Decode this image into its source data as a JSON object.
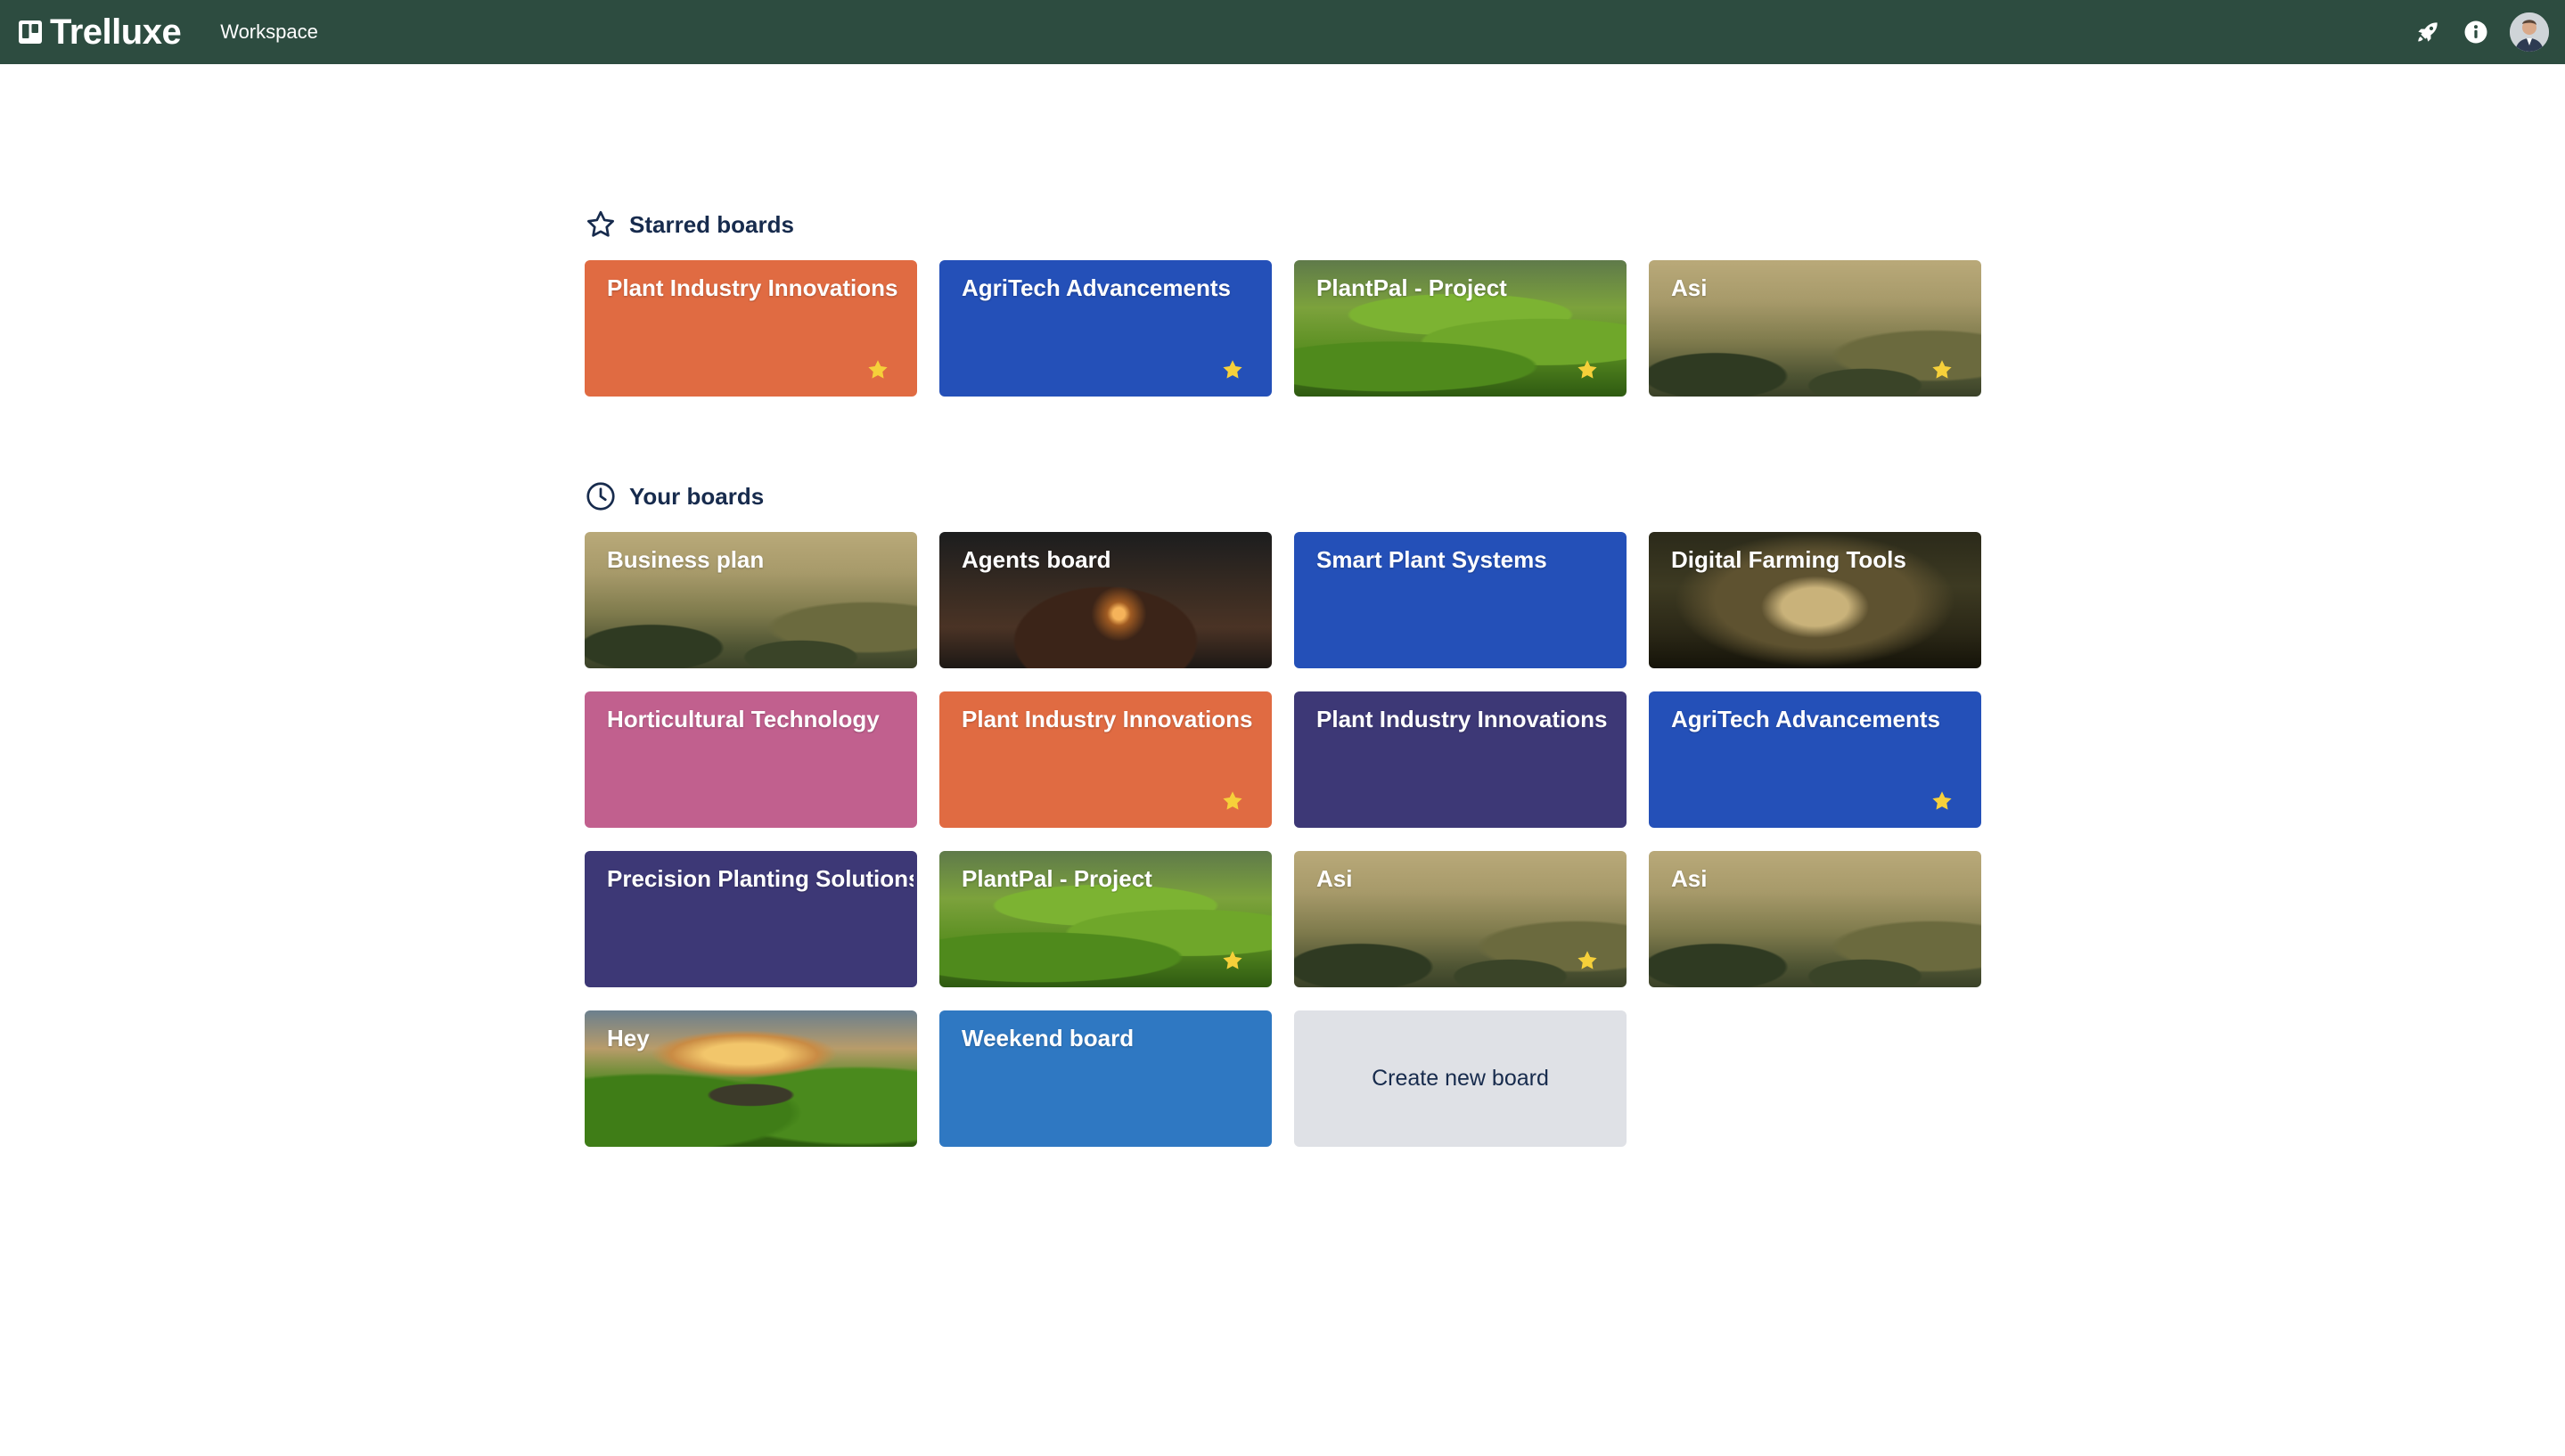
{
  "app": {
    "brand": "Trelluxe",
    "nav_workspace": "Workspace"
  },
  "sections": {
    "starred": {
      "title": "Starred boards",
      "boards": [
        {
          "title": "Plant Industry Innovations",
          "bg": "orange",
          "starred": true
        },
        {
          "title": "AgriTech Advancements",
          "bg": "blue",
          "starred": true
        },
        {
          "title": "PlantPal - Project",
          "bg": "hills-image",
          "starred": true
        },
        {
          "title": "Asi",
          "bg": "mountain-image",
          "starred": true
        }
      ]
    },
    "yours": {
      "title": "Your boards",
      "boards": [
        {
          "title": "Business plan",
          "bg": "mountain-image",
          "starred": false
        },
        {
          "title": "Agents board",
          "bg": "tunnel-image",
          "starred": false
        },
        {
          "title": "Smart Plant Systems",
          "bg": "blue",
          "starred": false
        },
        {
          "title": "Digital Farming Tools",
          "bg": "forest-image",
          "starred": false
        },
        {
          "title": "Horticultural Technology",
          "bg": "pink",
          "starred": false
        },
        {
          "title": "Plant Industry Innovations",
          "bg": "orange",
          "starred": true
        },
        {
          "title": "Plant Industry Innovations",
          "bg": "purple",
          "starred": false
        },
        {
          "title": "AgriTech Advancements",
          "bg": "blue",
          "starred": true
        },
        {
          "title": "Precision Planting Solutions",
          "bg": "purple",
          "starred": false
        },
        {
          "title": "PlantPal - Project",
          "bg": "hills-image",
          "starred": true
        },
        {
          "title": "Asi",
          "bg": "mountain-image",
          "starred": true
        },
        {
          "title": "Asi",
          "bg": "mountain-image",
          "starred": false
        },
        {
          "title": "Hey",
          "bg": "valley-image",
          "starred": false
        },
        {
          "title": "Weekend board",
          "bg": "light-blue",
          "starred": false
        }
      ],
      "create_label": "Create new board"
    }
  },
  "colors": {
    "topbar": "#2d4c40",
    "orange": "#e06b42",
    "blue": "#2450b8",
    "light-blue": "#2f78c2",
    "pink": "#c1608e",
    "purple": "#3d3876",
    "star": "#f6d03a",
    "create_bg": "#dfe1e6",
    "heading": "#172b4d"
  },
  "icons": {
    "logo": "board-logo-icon",
    "launch": "rocket-icon",
    "info": "info-icon",
    "starred_section": "star-outline-icon",
    "recent_section": "clock-icon",
    "board_star": "star-filled-icon"
  }
}
